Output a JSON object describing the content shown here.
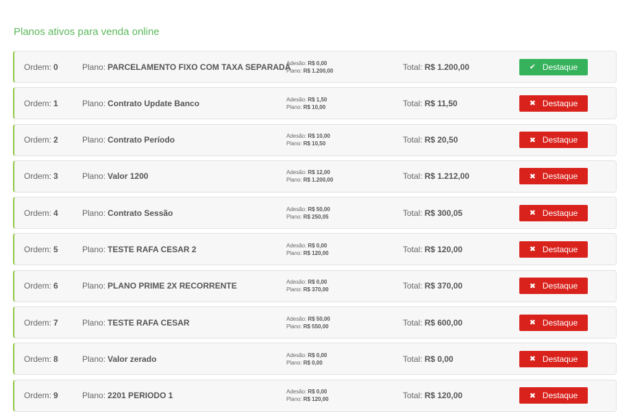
{
  "page": {
    "title": "Planos ativos para venda online"
  },
  "labels": {
    "ordem": "Ordem:",
    "plano": "Plano:",
    "adesao": "Adesão:",
    "plano_fee": "Plano:",
    "total": "Total:",
    "destaque": "Destaque"
  },
  "icons": {
    "on": "check-icon",
    "off": "close-icon"
  },
  "colors": {
    "title": "#5cb85c",
    "row_accent": "#8dc63f",
    "highlight_on": "#35b25b",
    "highlight_off": "#d9221c"
  },
  "plans": [
    {
      "ordem": "0",
      "plano": "PARCELAMENTO FIXO COM TAXA SEPARADA",
      "adesao": "R$ 0,00",
      "plano_fee": "R$ 1.200,00",
      "total": "R$ 1.200,00",
      "destaque": true
    },
    {
      "ordem": "1",
      "plano": "Contrato Update Banco",
      "adesao": "R$ 1,50",
      "plano_fee": "R$ 10,00",
      "total": "R$ 11,50",
      "destaque": false
    },
    {
      "ordem": "2",
      "plano": "Contrato Período",
      "adesao": "R$ 10,00",
      "plano_fee": "R$ 10,50",
      "total": "R$ 20,50",
      "destaque": false
    },
    {
      "ordem": "3",
      "plano": "Valor 1200",
      "adesao": "R$ 12,00",
      "plano_fee": "R$ 1.200,00",
      "total": "R$ 1.212,00",
      "destaque": false
    },
    {
      "ordem": "4",
      "plano": "Contrato Sessão",
      "adesao": "R$ 50,00",
      "plano_fee": "R$ 250,05",
      "total": "R$ 300,05",
      "destaque": false
    },
    {
      "ordem": "5",
      "plano": "TESTE RAFA CESAR 2",
      "adesao": "R$ 0,00",
      "plano_fee": "R$ 120,00",
      "total": "R$ 120,00",
      "destaque": false
    },
    {
      "ordem": "6",
      "plano": "PLANO PRIME 2X RECORRENTE",
      "adesao": "R$ 0,00",
      "plano_fee": "R$ 370,00",
      "total": "R$ 370,00",
      "destaque": false
    },
    {
      "ordem": "7",
      "plano": "TESTE RAFA CESAR",
      "adesao": "R$ 50,00",
      "plano_fee": "R$ 550,00",
      "total": "R$ 600,00",
      "destaque": false
    },
    {
      "ordem": "8",
      "plano": "Valor zerado",
      "adesao": "R$ 0,00",
      "plano_fee": "R$ 0,00",
      "total": "R$ 0,00",
      "destaque": false
    },
    {
      "ordem": "9",
      "plano": "2201 PERIODO 1",
      "adesao": "R$ 0,00",
      "plano_fee": "R$ 120,00",
      "total": "R$ 120,00",
      "destaque": false
    }
  ]
}
